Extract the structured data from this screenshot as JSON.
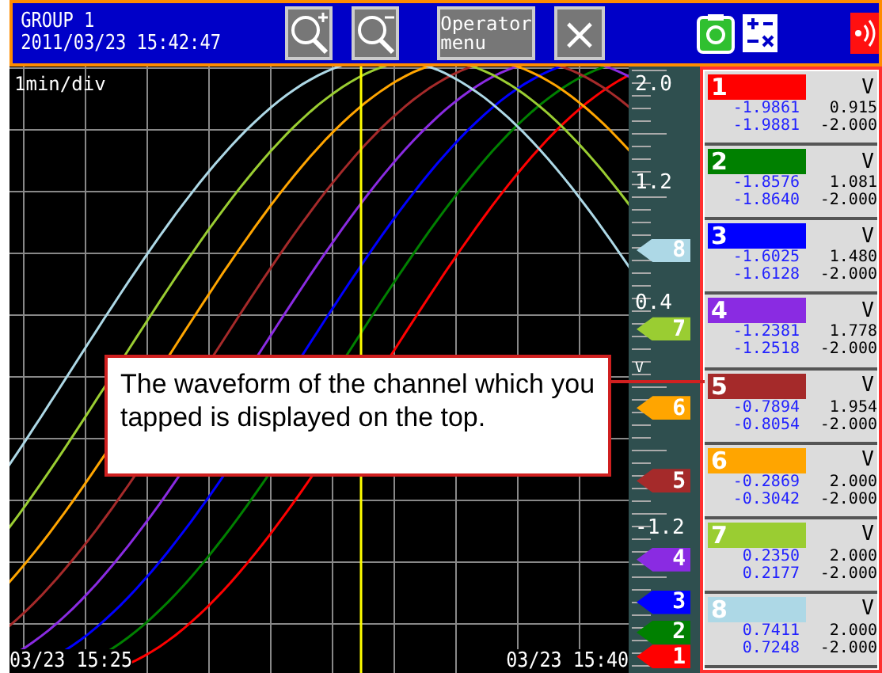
{
  "header": {
    "group": "GROUP 1",
    "datetime": "2011/03/23 15:42:47",
    "operator_button": "Operator\nmenu",
    "close_button": "×"
  },
  "chart": {
    "time_division": "1min/div",
    "time_start": "03/23 15:25",
    "time_end": "03/23 15:40"
  },
  "scale": {
    "labels": [
      "2.0",
      "1.2",
      "0.4",
      "V",
      "-1.2"
    ],
    "markers": [
      {
        "label": "8",
        "color": "#add8e6",
        "level": 0.68
      },
      {
        "label": "7",
        "color": "#9acd32",
        "level": 0.55
      },
      {
        "label": "6",
        "color": "#ffa500",
        "level": 0.42
      },
      {
        "label": "5",
        "color": "#a52a2a",
        "level": 0.3
      },
      {
        "label": "4",
        "color": "#8a2be2",
        "level": 0.17
      },
      {
        "label": "3",
        "color": "#0000ff",
        "level": 0.1
      },
      {
        "label": "2",
        "color": "#008000",
        "level": 0.05
      },
      {
        "label": "1",
        "color": "#ff0000",
        "level": 0.01
      }
    ]
  },
  "channels": [
    {
      "number": "1",
      "color": "#ff0000",
      "unit": "V",
      "value_a": "-1.9861",
      "value_b": "-1.9881",
      "max": "0.915",
      "min": "-2.000"
    },
    {
      "number": "2",
      "color": "#008000",
      "unit": "V",
      "value_a": "-1.8576",
      "value_b": "-1.8640",
      "max": "1.081",
      "min": "-2.000"
    },
    {
      "number": "3",
      "color": "#0000ff",
      "unit": "V",
      "value_a": "-1.6025",
      "value_b": "-1.6128",
      "max": "1.480",
      "min": "-2.000"
    },
    {
      "number": "4",
      "color": "#8a2be2",
      "unit": "V",
      "value_a": "-1.2381",
      "value_b": "-1.2518",
      "max": "1.778",
      "min": "-2.000"
    },
    {
      "number": "5",
      "color": "#a52a2a",
      "unit": "V",
      "value_a": "-0.7894",
      "value_b": "-0.8054",
      "max": "1.954",
      "min": "-2.000"
    },
    {
      "number": "6",
      "color": "#ffa500",
      "unit": "V",
      "value_a": "-0.2869",
      "value_b": "-0.3042",
      "max": "2.000",
      "min": "-2.000"
    },
    {
      "number": "7",
      "color": "#9acd32",
      "unit": "V",
      "value_a": "0.2350",
      "value_b": "0.2177",
      "max": "2.000",
      "min": "-2.000"
    },
    {
      "number": "8",
      "color": "#add8e6",
      "unit": "V",
      "value_a": "0.7411",
      "value_b": "0.7248",
      "max": "2.000",
      "min": "-2.000"
    }
  ],
  "callout": {
    "text": "The waveform of the channel which you tapped is displayed on the top."
  }
}
